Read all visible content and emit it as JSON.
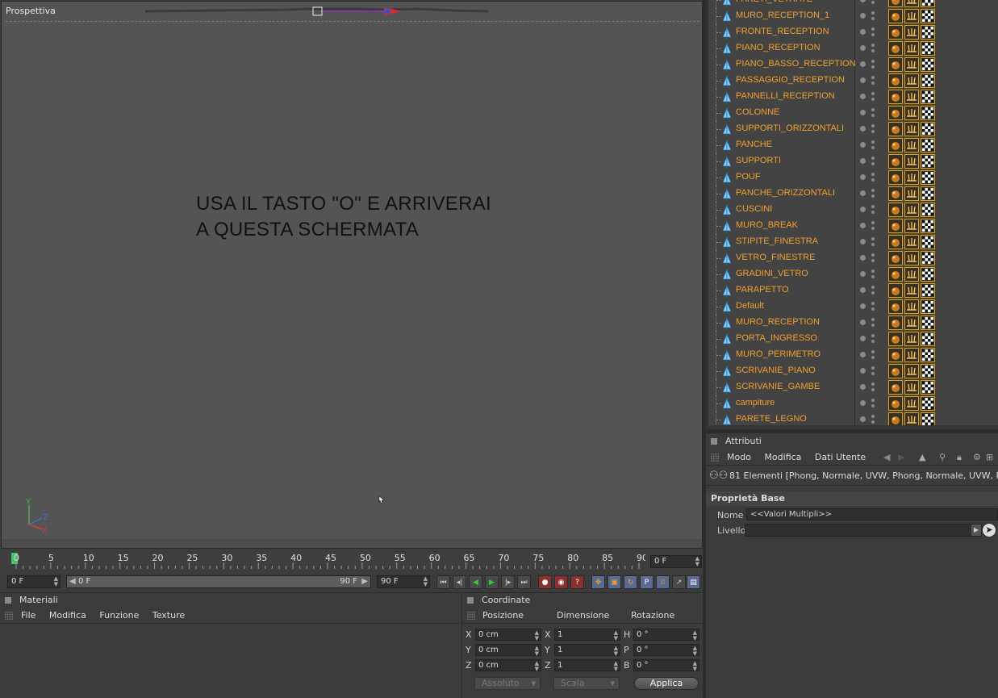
{
  "viewport": {
    "title": "Prospettiva",
    "overlay_line1": "USA IL TASTO \"O\" E ARRIVERAI",
    "overlay_line2": "A QUESTA SCHERMATA",
    "axis_labels": {
      "y": "Y",
      "z": "Z",
      "x": "X"
    }
  },
  "timeline": {
    "ticks": [
      "0",
      "5",
      "10",
      "15",
      "20",
      "25",
      "30",
      "35",
      "40",
      "45",
      "50",
      "55",
      "60",
      "65",
      "70",
      "75",
      "80",
      "85",
      "90"
    ],
    "current_frame": "0 F"
  },
  "transport": {
    "start_frame": "0 F",
    "range_start": "0 F",
    "range_end": "90 F",
    "end_frame": "90 F"
  },
  "materials_panel": {
    "title": "Materiali",
    "menu": [
      "File",
      "Modifica",
      "Funzione",
      "Texture"
    ]
  },
  "coordinates_panel": {
    "title": "Coordinate",
    "columns": [
      "Posizione",
      "Dimensione",
      "Rotazione"
    ],
    "rows": [
      {
        "axis": "X",
        "pos": "0 cm",
        "dim_axis": "X",
        "dim": "1",
        "rot_axis": "H",
        "rot": "0 °"
      },
      {
        "axis": "Y",
        "pos": "0 cm",
        "dim_axis": "Y",
        "dim": "1",
        "rot_axis": "P",
        "rot": "0 °"
      },
      {
        "axis": "Z",
        "pos": "0 cm",
        "dim_axis": "Z",
        "dim": "1",
        "rot_axis": "B",
        "rot": "0 °"
      }
    ],
    "mode_select": "Assoluto",
    "scale_select": "Scala",
    "apply_button": "Applica"
  },
  "object_manager": {
    "objects": [
      "PARETI_VETRATE",
      "MURO_RECEPTION_1",
      "FRONTE_RECEPTION",
      "PIANO_RECEPTION",
      "PIANO_BASSO_RECEPTION",
      "PASSAGGIO_RECEPTION",
      "PANNELLI_RECEPTION",
      "COLONNE",
      "SUPPORTI_ORIZZONTALI",
      "PANCHE",
      "SUPPORTI",
      "POUF",
      "PANCHE_ORIZZONTALI",
      "CUSCINI",
      "MURO_BREAK",
      "STIPITE_FINESTRA",
      "VETRO_FINESTRE",
      "GRADINI_VETRO",
      "PARAPETTO",
      "Default",
      "MURO_RECEPTION",
      "PORTA_INGRESSO",
      "MURO_PERIMETRO",
      "SCRIVANIE_PIANO",
      "SCRIVANIE_GAMBE",
      "campiture",
      "PARETE_LEGNO"
    ],
    "name_color": "#f0a030"
  },
  "attributes_panel": {
    "title": "Attributi",
    "menu": [
      "Modo",
      "Modifica",
      "Dati Utente"
    ],
    "selection_info": "81 Elementi [Phong, Normale, UVW, Phong, Normale, UVW, Phong, N",
    "section_title": "Proprietà Base",
    "name_label": "Nome",
    "name_value": "<<Valori Multipli>>",
    "layer_label": "Livello"
  }
}
